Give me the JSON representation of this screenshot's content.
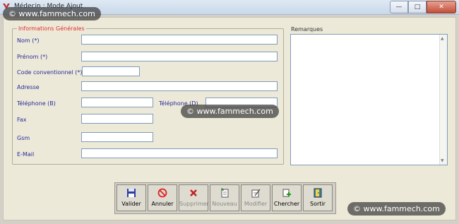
{
  "window": {
    "title": "Médecin : Mode Ajout",
    "minimize": "—",
    "maximize": "□",
    "close": "✕"
  },
  "group": {
    "title": "Informations Générales"
  },
  "fields": {
    "nom": {
      "label": "Nom (*)",
      "value": ""
    },
    "prenom": {
      "label": "Prénom (*)",
      "value": ""
    },
    "code": {
      "label": "Code conventionnel (*)",
      "value": ""
    },
    "adresse": {
      "label": "Adresse",
      "value": ""
    },
    "tel_b": {
      "label": "Téléphone (B)",
      "value": ""
    },
    "tel_d": {
      "label": "Téléphone (D)",
      "value": ""
    },
    "fax": {
      "label": "Fax",
      "value": ""
    },
    "gsm": {
      "label": "Gsm",
      "value": ""
    },
    "email": {
      "label": "E-Mail",
      "value": ""
    }
  },
  "remarks": {
    "label": "Remarques",
    "value": ""
  },
  "toolbar": {
    "valider": "Valider",
    "annuler": "Annuler",
    "supprimer": "Supprimer",
    "nouveau": "Nouveau",
    "modifier": "Modifier",
    "chercher": "Chercher",
    "sortir": "Sortir"
  },
  "watermarks": [
    "© www.fammech.com",
    "© www.fammech.com",
    "© www.fammech.com"
  ],
  "colors": {
    "group_title": "#e03030",
    "labels": "#2a2a9a"
  }
}
